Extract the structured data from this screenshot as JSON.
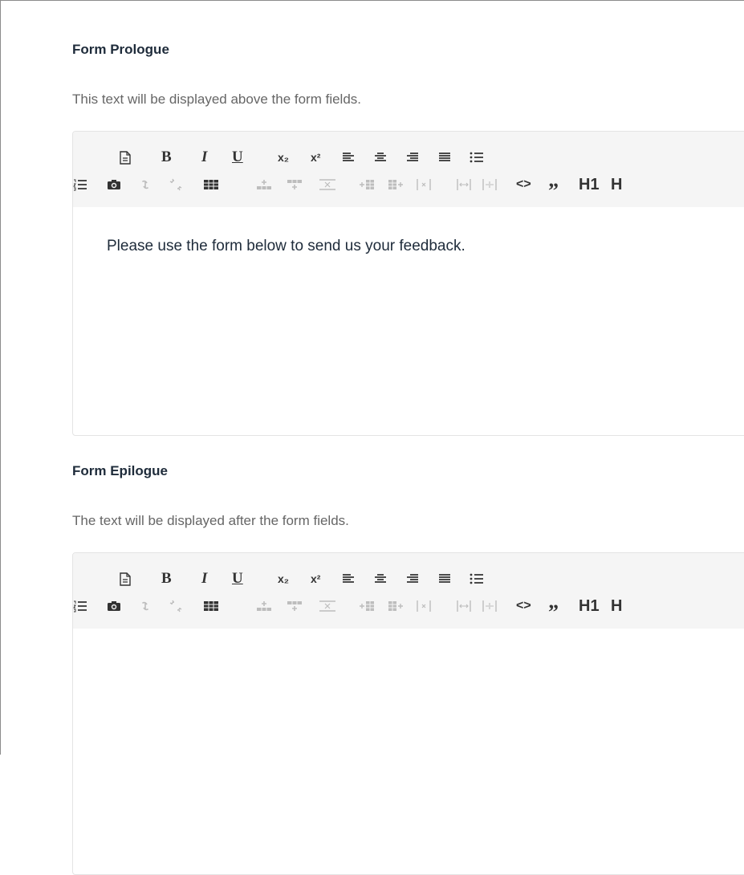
{
  "sections": [
    {
      "title": "Form Prologue",
      "description": "This text will be displayed above the form fields.",
      "content": "Please use the form below to send us your feedback."
    },
    {
      "title": "Form Epilogue",
      "description": "The text will be displayed after the form fields.",
      "content": ""
    }
  ],
  "toolbar": {
    "bold": "B",
    "italic": "I",
    "underline": "U",
    "subscript": "x₂",
    "superscript": "x²",
    "code": "<>",
    "quote": "”",
    "heading": "H1",
    "heading_partial": "H"
  },
  "colors": {
    "title": "#1e2b3a",
    "description": "#666666",
    "toolbar_bg": "#f5f5f5",
    "icon": "#333333",
    "icon_disabled": "#bdbdbd"
  }
}
